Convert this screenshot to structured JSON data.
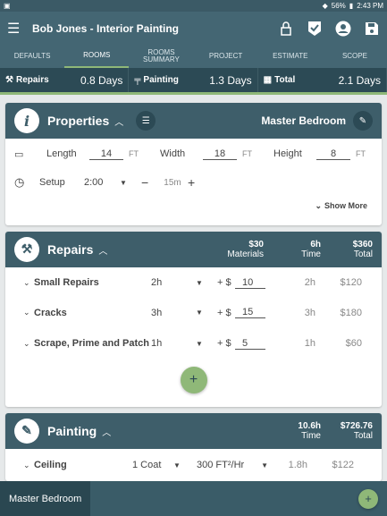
{
  "status": {
    "battery": "56%",
    "time": "2:43 PM"
  },
  "appbar": {
    "title": "Bob Jones - Interior Painting"
  },
  "tabs": [
    {
      "label": "DEFAULTS"
    },
    {
      "label": "ROOMS"
    },
    {
      "label": "ROOMS SUMMARY"
    },
    {
      "label": "PROJECT"
    },
    {
      "label": "ESTIMATE"
    },
    {
      "label": "SCOPE"
    }
  ],
  "summary": {
    "repairs": {
      "label": "Repairs",
      "value": "0.8 Days"
    },
    "painting": {
      "label": "Painting",
      "value": "1.3 Days"
    },
    "total": {
      "label": "Total",
      "value": "2.1 Days"
    }
  },
  "properties": {
    "title": "Properties",
    "room": "Master Bedroom",
    "length_label": "Length",
    "length": "14",
    "length_unit": "FT",
    "width_label": "Width",
    "width": "18",
    "width_unit": "FT",
    "height_label": "Height",
    "height": "8",
    "height_unit": "FT",
    "setup_label": "Setup",
    "setup_value": "2:00",
    "step": "15m",
    "show_more": "Show More"
  },
  "repairs": {
    "title": "Repairs",
    "materials_value": "$30",
    "materials_label": "Materials",
    "time_value": "6h",
    "time_label": "Time",
    "total_value": "$360",
    "total_label": "Total",
    "items": [
      {
        "name": "Small Repairs",
        "hours": "2h",
        "plus": "+ $",
        "cost": "10",
        "time": "2h",
        "total": "$120"
      },
      {
        "name": "Cracks",
        "hours": "3h",
        "plus": "+ $",
        "cost": "15",
        "time": "3h",
        "total": "$180"
      },
      {
        "name": "Scrape, Prime and Patch",
        "hours": "1h",
        "plus": "+ $",
        "cost": "5",
        "time": "1h",
        "total": "$60"
      }
    ]
  },
  "painting": {
    "title": "Painting",
    "time_value": "10.6h",
    "time_label": "Time",
    "total_value": "$726.76",
    "total_label": "Total",
    "items": [
      {
        "name": "Ceiling",
        "coats": "1 Coat",
        "rate": "300 FT²/Hr",
        "time": "1.8h",
        "total": "$122"
      }
    ]
  },
  "bottom": {
    "room_tab": "Master Bedroom"
  }
}
